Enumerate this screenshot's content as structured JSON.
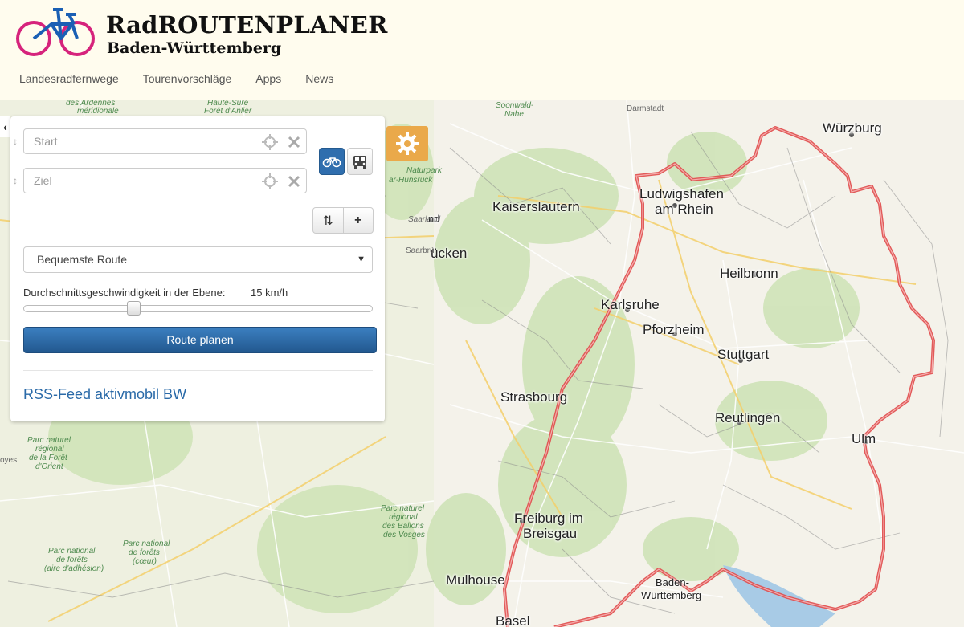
{
  "brand": {
    "title": "RadROUTENPLANER",
    "subtitle": "Baden-Württemberg",
    "logo_icon": "bicycle-icon",
    "colors": {
      "wheel": "#d6237c",
      "frame": "#1a5fb4"
    }
  },
  "nav": {
    "items": [
      "Landesradfernwege",
      "Tourenvorschläge",
      "Apps",
      "News"
    ]
  },
  "panel": {
    "start_placeholder": "Start",
    "ziel_placeholder": "Ziel",
    "mode_bike_icon": "bicycle-icon",
    "mode_transit_icon": "bus-icon",
    "swap_label": "⇅",
    "add_label": "+",
    "route_type": "Bequemste Route",
    "speed_label": "Durchschnittsgeschwindigkeit in der Ebene:",
    "speed_value": "15 km/h",
    "plan_button": "Route planen",
    "rss_link": "RSS-Feed aktivmobil BW",
    "accent_color": "#2a6aa8",
    "settings_icon": "gear-icon"
  },
  "map": {
    "cities": [
      "Würzburg",
      "Kaiserslautern",
      "Ludwigshafen",
      "am Rhein",
      "Heilbronn",
      "Karlsruhe",
      "Pforzheim",
      "Stuttgart",
      "Strasbourg",
      "Reutlingen",
      "Ulm",
      "Freiburg im",
      "Breisgau",
      "Mulhouse",
      "Baden-",
      "Württemberg",
      "Basel",
      "ücken",
      "nd"
    ],
    "small_labels": [
      "Darmstadt",
      "Soonwald-",
      "Nahe",
      "Naturpark",
      "ar-Hunsrück",
      "Saarland",
      "Saarbrü",
      "des Ardennes",
      "méridionale",
      "Haute-Sûre",
      "Forêt d'Anlier",
      "Parc naturel",
      "régional",
      "de la Forêt",
      "d'Orient",
      "Parc naturel",
      "régional",
      "des Ballons",
      "des Vosges",
      "Parc national",
      "de forêts",
      "(aire d'adhésion)",
      "Parc national",
      "de forêts",
      "(cœur)",
      "oyes"
    ],
    "route_color": "#e04a4a"
  }
}
